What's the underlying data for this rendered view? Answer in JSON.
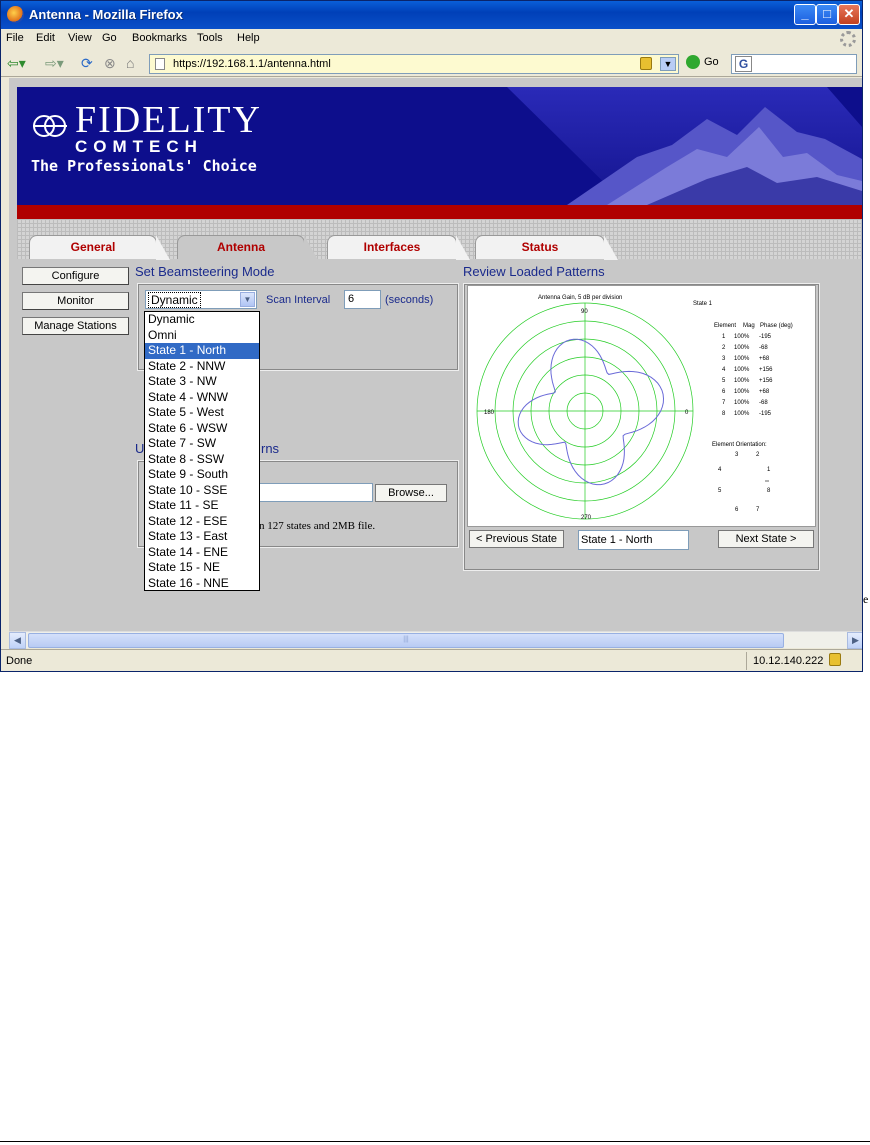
{
  "window": {
    "title": "Antenna - Mozilla Firefox"
  },
  "menu": [
    "File",
    "Edit",
    "View",
    "Go",
    "Bookmarks",
    "Tools",
    "Help"
  ],
  "nav": {
    "url": "https://192.168.1.1/antenna.html",
    "go_label": "Go",
    "search_engine_letter": "G"
  },
  "brand": {
    "name": "FIDELITY",
    "sub": "COMTECH",
    "tagline": "The Professionals' Choice"
  },
  "tabs": [
    {
      "label": "General",
      "active": false
    },
    {
      "label": "Antenna",
      "active": true
    },
    {
      "label": "Interfaces",
      "active": false
    },
    {
      "label": "Status",
      "active": false
    }
  ],
  "sidebar": [
    "Configure",
    "Monitor",
    "Manage Stations"
  ],
  "beamsteering": {
    "title": "Set Beamsteering Mode",
    "selected": "Dynamic",
    "scan_label": "Scan Interval",
    "scan_value": "6",
    "scan_unit": "(seconds)",
    "options": [
      "Dynamic",
      "Omni",
      "State 1 - North",
      "State 2 - NNW",
      "State 3 - NW",
      "State 4 - WNW",
      "State 5 - West",
      "State 6 - WSW",
      "State 7 - SW",
      "State 8 - SSW",
      "State 9 - South",
      "State 10 - SSE",
      "State 11 - SE",
      "State 12 - ESE",
      "State 13 - East",
      "State 14 - ENE",
      "State 15 - NE",
      "State 16 - NNE"
    ],
    "highlighted": "State 1 - North"
  },
  "upload": {
    "title_fragment_left": "U",
    "title_fragment_right": "rns",
    "browse_label": "Browse...",
    "limit_text": "n 127 states and 2MB file."
  },
  "review": {
    "title": "Review Loaded Patterns",
    "prev_label": "< Previous State",
    "next_label": "Next State >",
    "current_state": "State 1 - North"
  },
  "plot": {
    "caption": "Antenna Gain, 5 dB per division",
    "state_label": "State 1",
    "angle_labels": [
      "90",
      "0",
      "270",
      "180"
    ],
    "table_headers": [
      "Element",
      "Mag",
      "Phase (deg)"
    ],
    "table": [
      [
        "1",
        "100%",
        "-195"
      ],
      [
        "2",
        "100%",
        "-68"
      ],
      [
        "3",
        "100%",
        "+68"
      ],
      [
        "4",
        "100%",
        "+156"
      ],
      [
        "5",
        "100%",
        "+156"
      ],
      [
        "6",
        "100%",
        "+68"
      ],
      [
        "7",
        "100%",
        "-68"
      ],
      [
        "8",
        "100%",
        "-195"
      ]
    ],
    "orientation_title": "Element Orientation:",
    "orientation_labels": [
      "3",
      "2",
      "4",
      "1",
      "5",
      "8",
      "6",
      "7"
    ],
    "pattern_color": "#6a6ad8",
    "grid_color": "#22cc22"
  },
  "right_edge_chars": [
    "I",
    "I",
    "I",
    "e"
  ],
  "status": {
    "text": "Done",
    "ip": "10.12.140.222"
  },
  "colors": {
    "header_navy": "#0d0e8c",
    "header_red": "#b00000",
    "tab_text": "#b00000",
    "section_title": "#1a2a8c",
    "selection_blue": "#316ac5"
  }
}
